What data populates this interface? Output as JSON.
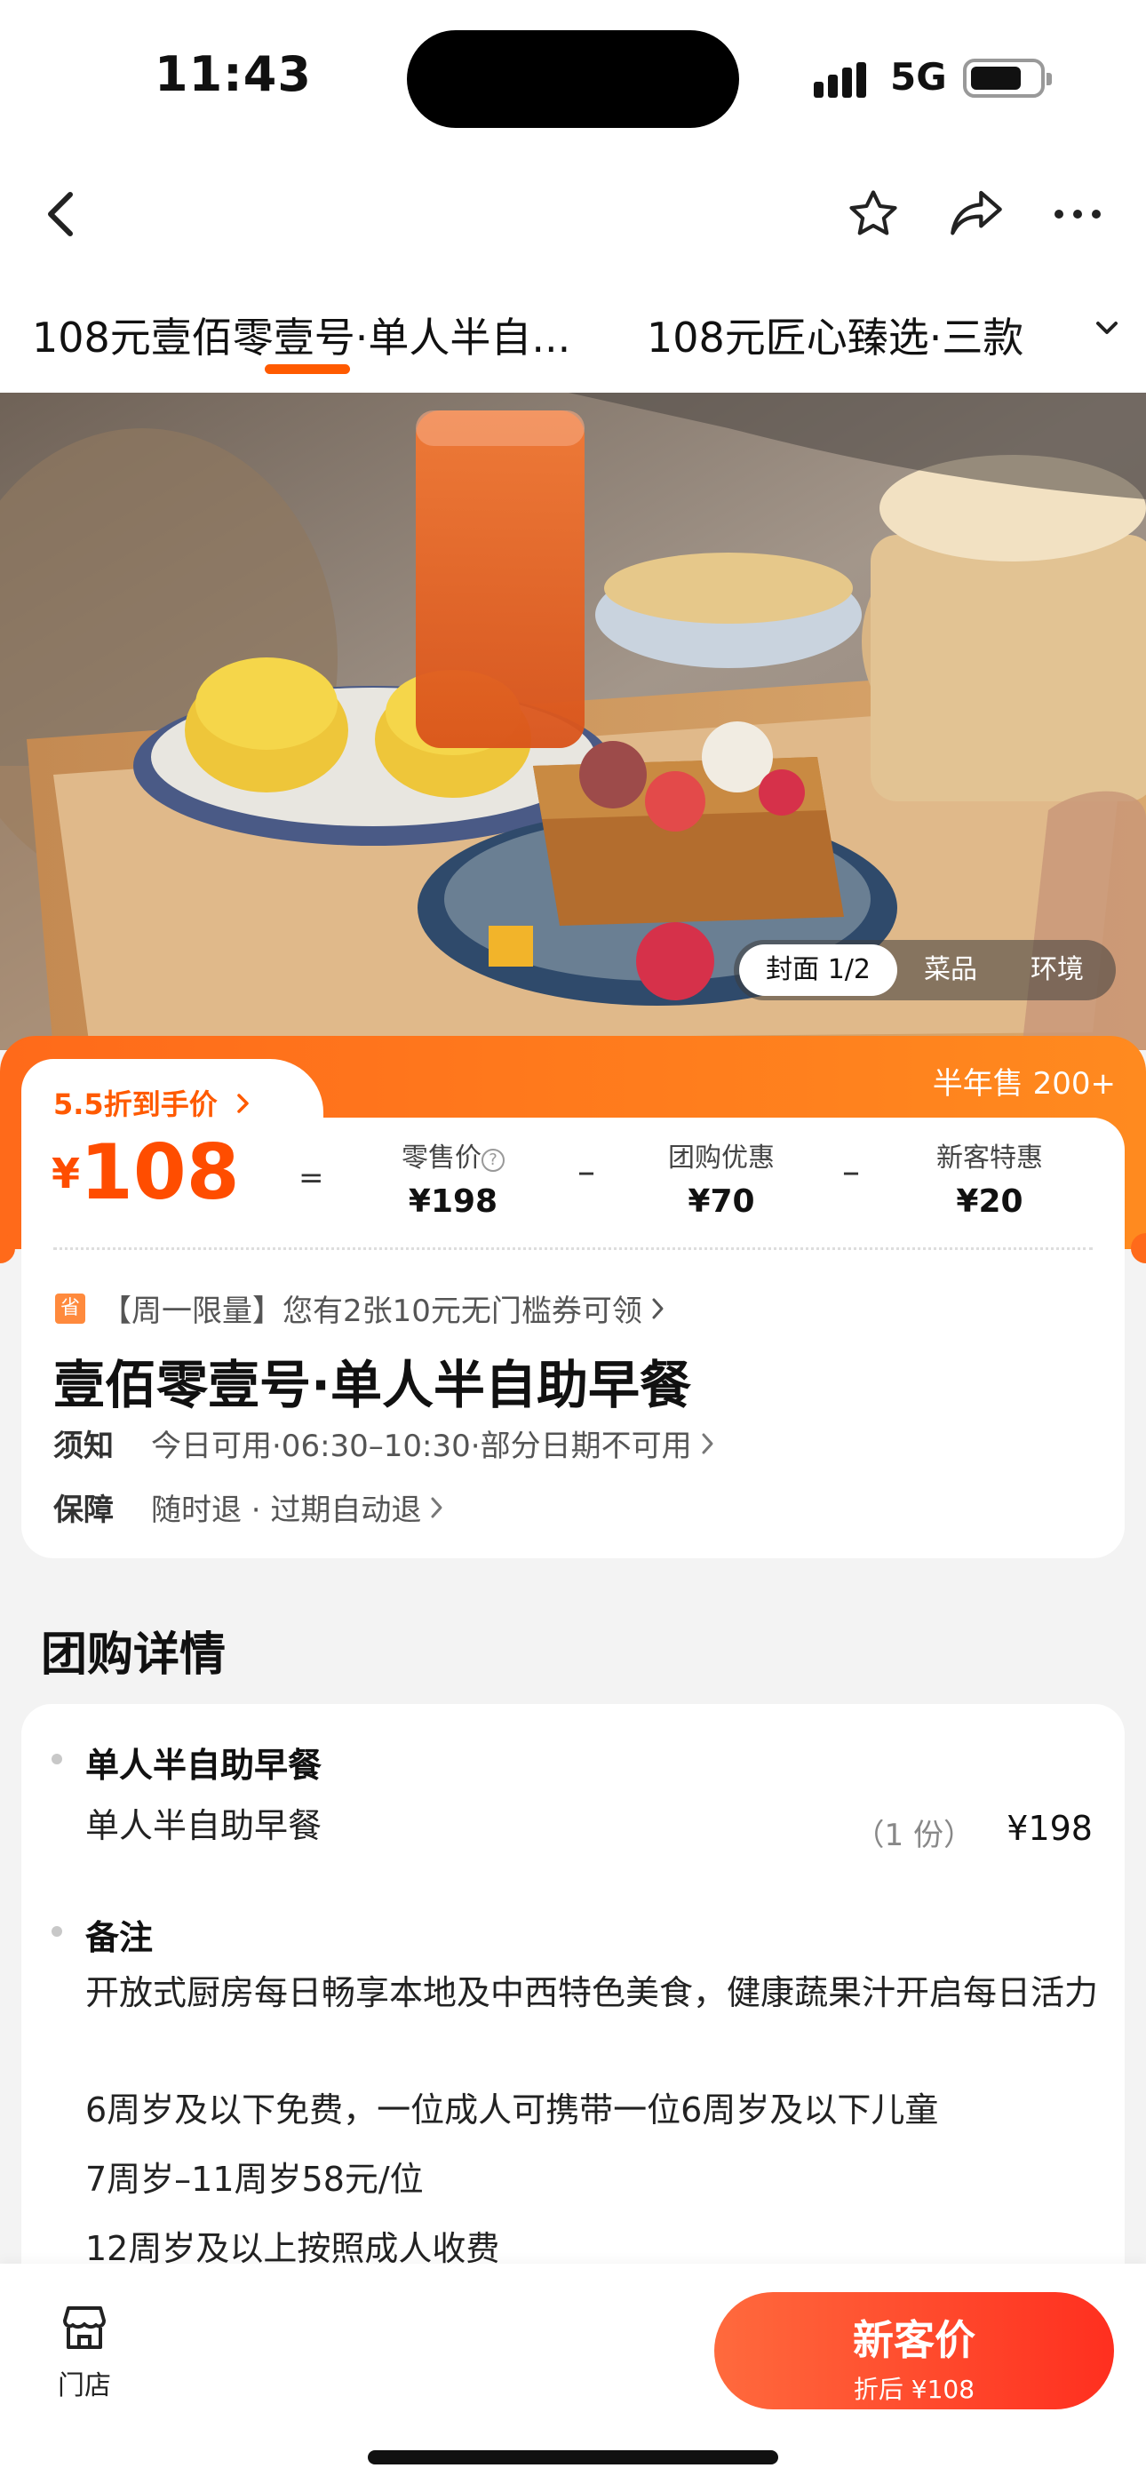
{
  "status": {
    "time": "11:43",
    "network": "5G"
  },
  "tabs": [
    {
      "label": "108元壹佰零壹号·单人半自..."
    },
    {
      "label": "108元匠心臻选·三款"
    }
  ],
  "gallery": {
    "pills": [
      "封面 1/2",
      "菜品",
      "环境"
    ],
    "active": 0
  },
  "price": {
    "promo": "5.5折到手价",
    "sold": "半年售 200+",
    "currency": "¥",
    "value": "108",
    "equals": "=",
    "minus": "–",
    "retail_label": "零售价",
    "retail_value": "¥198",
    "group_label": "团购优惠",
    "group_value": "¥70",
    "new_label": "新客特惠",
    "new_value": "¥20"
  },
  "coupon": {
    "badge": "省",
    "text": "【周一限量】您有2张10元无门槛券可领"
  },
  "deal": {
    "title": "壹佰零壹号·单人半自助早餐",
    "notice_key": "须知",
    "notice_value": "今日可用·06:30–10:30·部分日期不可用",
    "guarantee_key": "保障",
    "guarantee_value": "随时退 · 过期自动退"
  },
  "details": {
    "section_title": "团购详情",
    "item_heading": "单人半自助早餐",
    "item_name": "单人半自助早餐",
    "item_qty": "（1 份）",
    "item_price": "¥198",
    "notes_heading": "备注",
    "notes": [
      "开放式厨房每日畅享本地及中西特色美食，健康蔬果汁开启每日活力",
      "6周岁及以下免费，一位成人可携带一位6周岁及以下儿童",
      "7周岁–11周岁58元/位",
      "12周岁及以上按照成人收费"
    ]
  },
  "bottom": {
    "store_label": "门店",
    "cta_main": "新客价",
    "cta_sub": "折后 ¥108"
  },
  "colors": {
    "accent": "#ff5a00",
    "cta": "#ff2f1f"
  }
}
